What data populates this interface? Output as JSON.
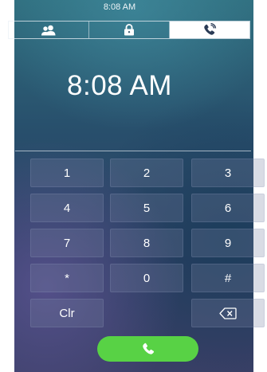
{
  "status_bar": {
    "time": "8:08 AM"
  },
  "tabs": [
    {
      "icon": "contacts-icon",
      "active": false
    },
    {
      "icon": "lock-icon",
      "active": false
    },
    {
      "icon": "phone-call-icon",
      "active": true
    }
  ],
  "clock": {
    "time": "8:08 AM"
  },
  "keypad": {
    "keys": [
      "1",
      "2",
      "3",
      "4",
      "5",
      "6",
      "7",
      "8",
      "9",
      "*",
      "0",
      "#"
    ],
    "clear_label": "Clr",
    "backspace_icon": "backspace-icon"
  },
  "call_button": {
    "icon": "phone-icon",
    "color": "#58d245"
  }
}
